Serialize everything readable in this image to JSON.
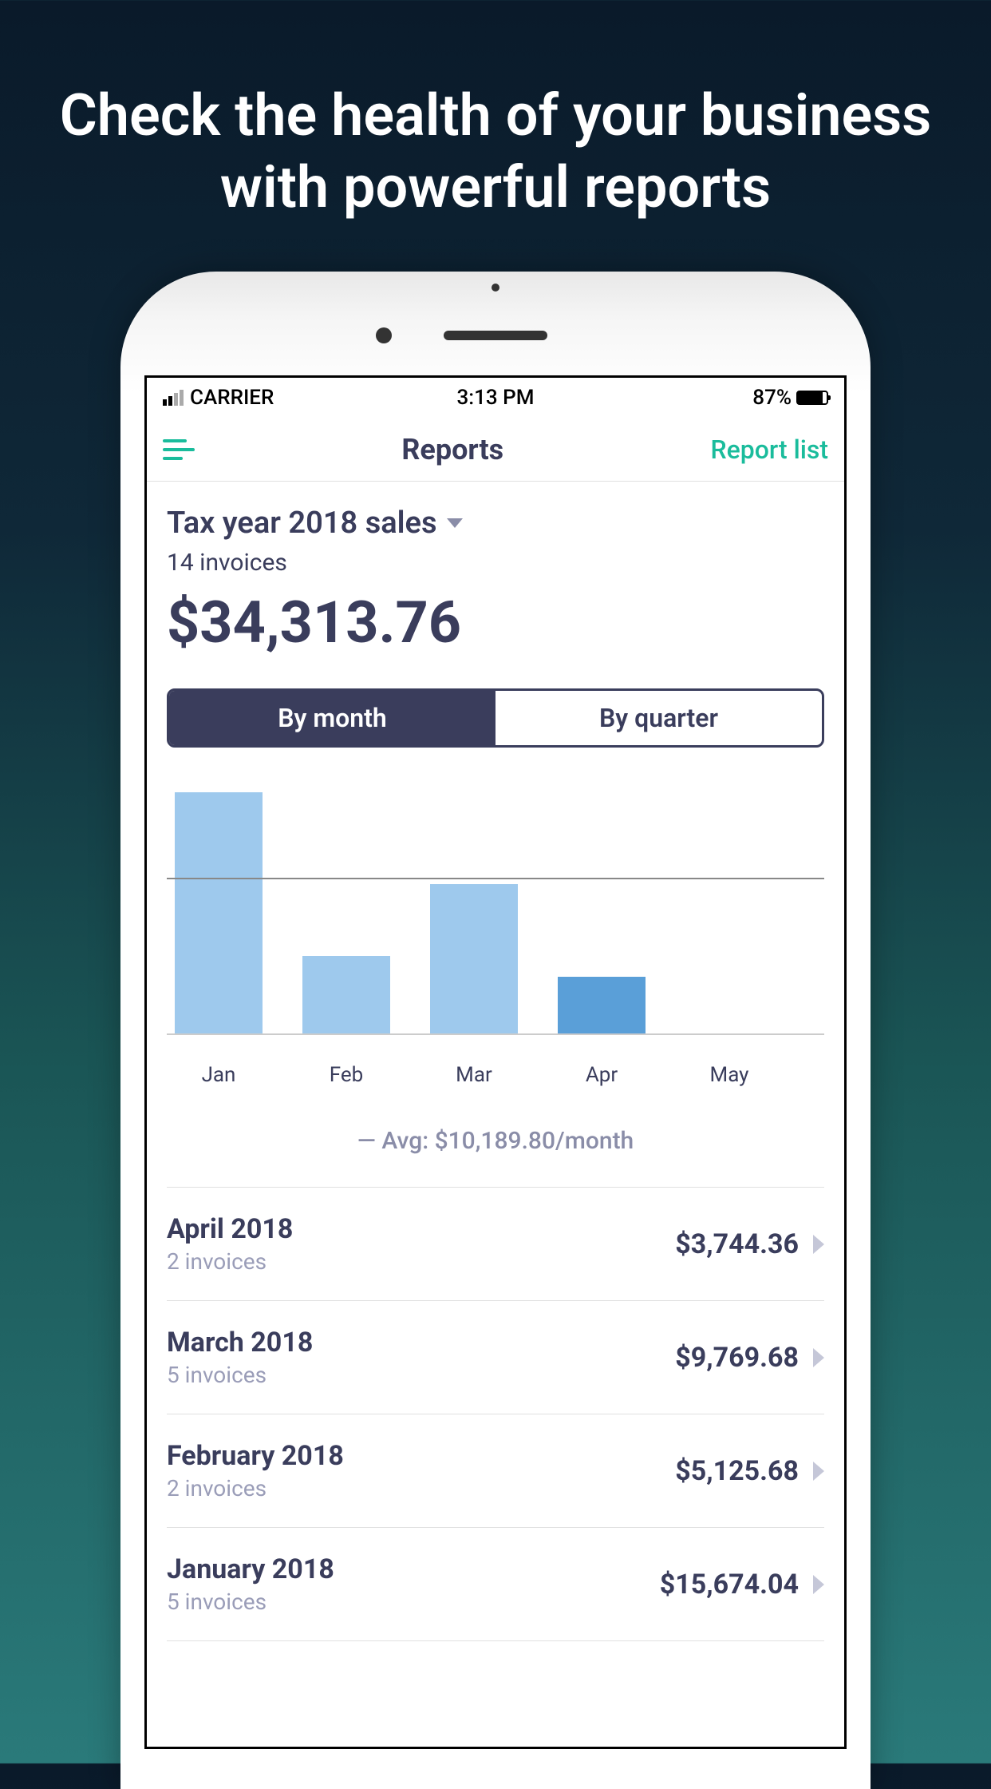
{
  "promo": {
    "headline": "Check the health of your business with powerful reports"
  },
  "status_bar": {
    "carrier": "CARRIER",
    "time": "3:13 PM",
    "battery_pct": "87%"
  },
  "nav": {
    "title": "Reports",
    "action": "Report list"
  },
  "report": {
    "selector_label": "Tax year 2018 sales",
    "invoice_count": "14 invoices",
    "total": "$34,313.76"
  },
  "segments": {
    "by_month": "By month",
    "by_quarter": "By quarter"
  },
  "chart_data": {
    "type": "bar",
    "categories": [
      "Jan",
      "Feb",
      "Mar",
      "Apr",
      "May"
    ],
    "values": [
      15674.04,
      5125.68,
      9769.68,
      3744.36,
      0
    ],
    "highlighted_index": 3,
    "avg_label": "— Avg: $10,189.80/month",
    "gridline_value": 10189.8,
    "ylim": [
      0,
      16000
    ]
  },
  "rows": [
    {
      "month": "April 2018",
      "sub": "2 invoices",
      "amount": "$3,744.36"
    },
    {
      "month": "March 2018",
      "sub": "5 invoices",
      "amount": "$9,769.68"
    },
    {
      "month": "February 2018",
      "sub": "2 invoices",
      "amount": "$5,125.68"
    },
    {
      "month": "January 2018",
      "sub": "5 invoices",
      "amount": "$15,674.04"
    }
  ]
}
